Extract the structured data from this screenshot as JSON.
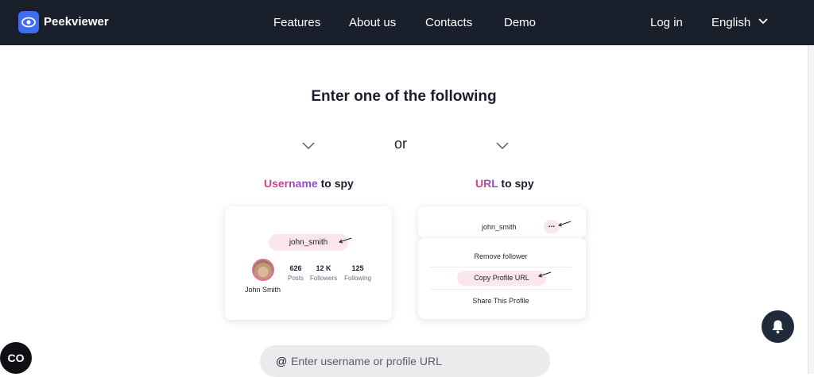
{
  "nav": {
    "brand": "Peekviewer",
    "links": [
      "Features",
      "About us",
      "Contacts",
      "Demo"
    ],
    "login": "Log in",
    "language": "English"
  },
  "main": {
    "heading": "Enter one of the following",
    "or": "or",
    "username_label": {
      "highlight": "Username",
      "rest": " to spy"
    },
    "url_label": {
      "highlight": "URL",
      "rest": " to spy"
    }
  },
  "username_card": {
    "username": "john_smith",
    "name": "John Smith",
    "stats": [
      {
        "value": "626",
        "label": "Posts"
      },
      {
        "value": "12 K",
        "label": "Followers"
      },
      {
        "value": "125",
        "label": "Following"
      }
    ]
  },
  "url_card": {
    "username": "john_smith",
    "more": "...",
    "menu": [
      "Remove follower",
      "Copy Profile URL",
      "Share This Profile"
    ]
  },
  "search": {
    "at": "@",
    "placeholder": "Enter username or profile URL"
  },
  "widget": {
    "co_label": "CO"
  },
  "colors": {
    "nav_bg": "#1a1f2c",
    "accent_blue": "#3d6df2",
    "pill_pink": "#fbe6ea",
    "bell_bg": "#1f2b3a"
  }
}
